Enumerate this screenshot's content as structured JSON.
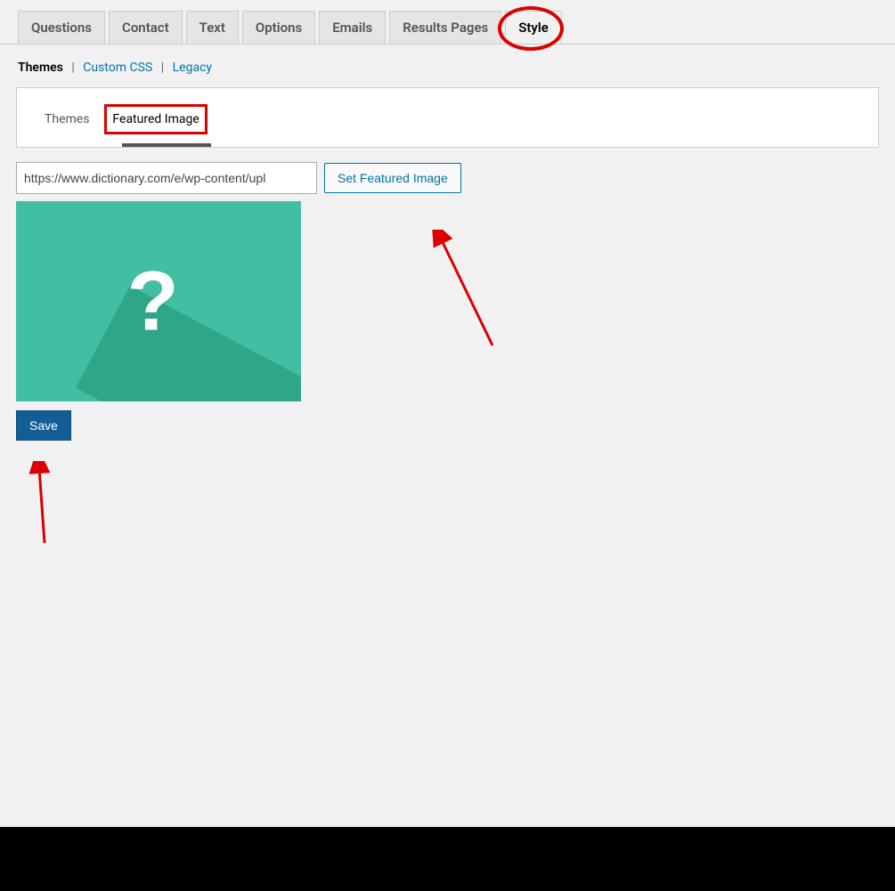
{
  "topTabs": {
    "questions": "Questions",
    "contact": "Contact",
    "text": "Text",
    "options": "Options",
    "emails": "Emails",
    "results": "Results Pages",
    "style": "Style"
  },
  "subnav": {
    "themes": "Themes",
    "customCss": "Custom CSS",
    "legacy": "Legacy"
  },
  "panelTabs": {
    "themes": "Themes",
    "featuredImage": "Featured Image"
  },
  "form": {
    "urlValue": "https://www.dictionary.com/e/wp-content/upl",
    "setFeatured": "Set Featured Image",
    "save": "Save"
  }
}
